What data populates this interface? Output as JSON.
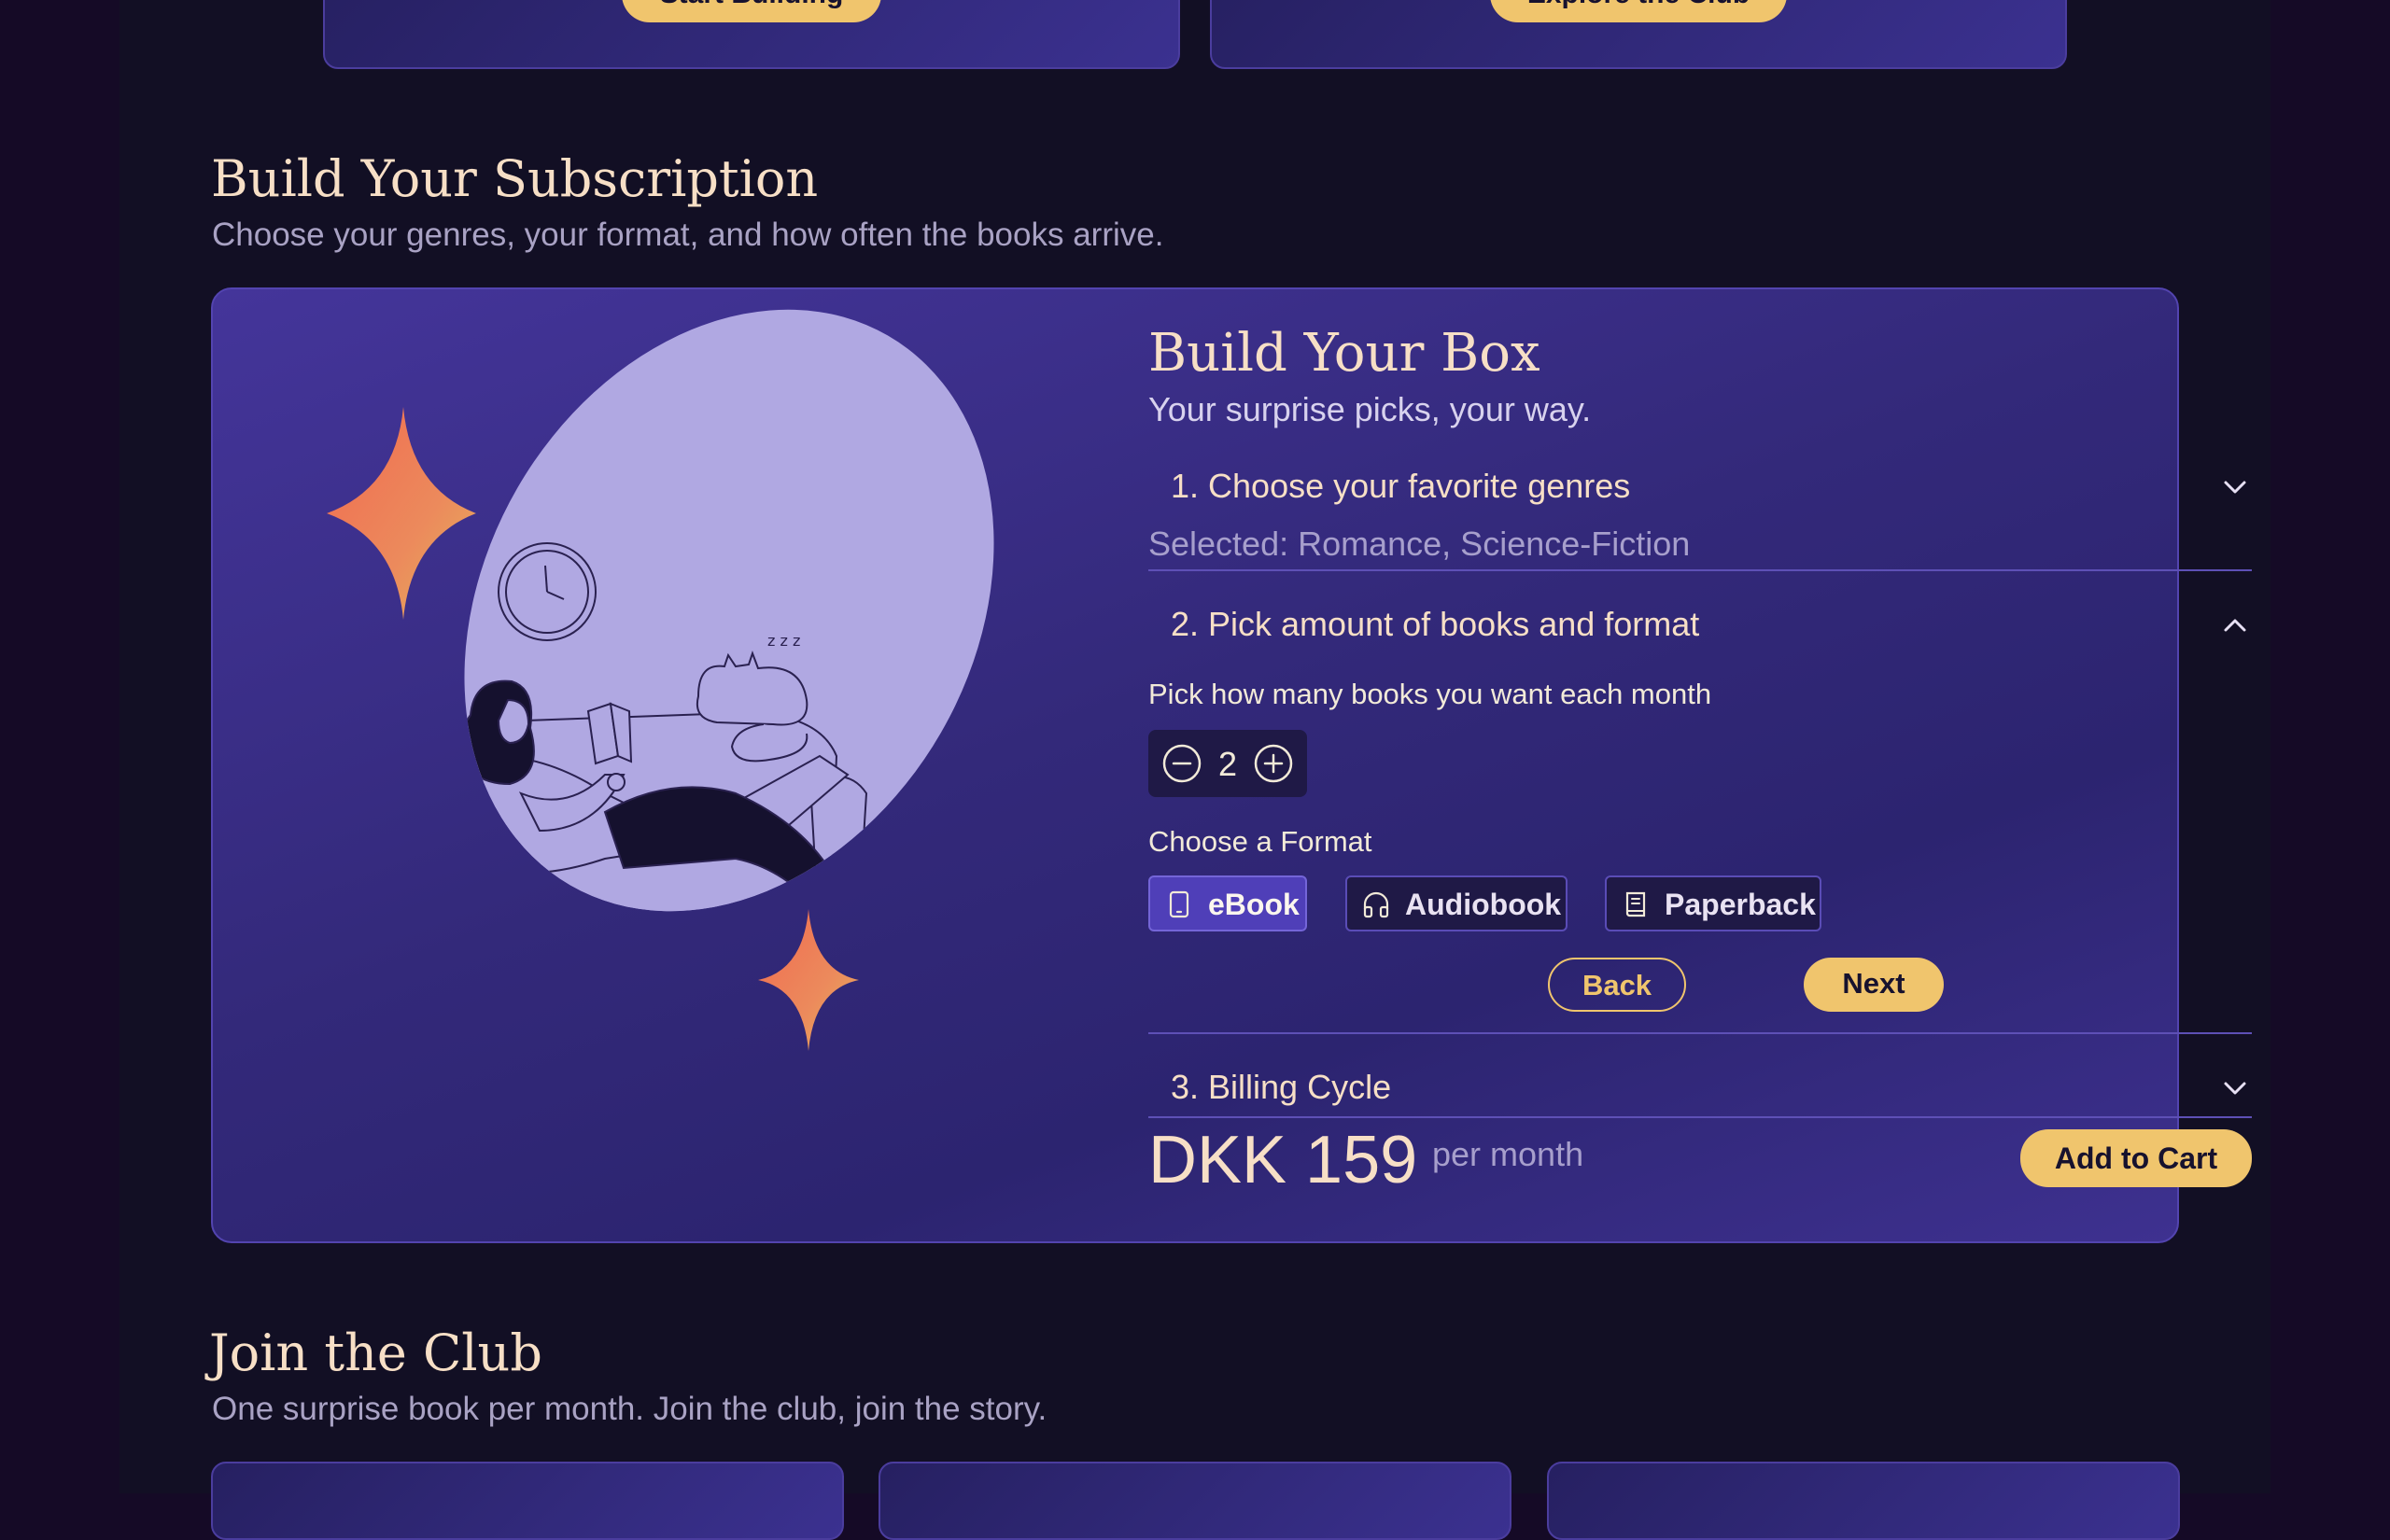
{
  "top_cards": {
    "left_button": "Start Building",
    "right_button": "Explore the Club"
  },
  "subscription_section": {
    "title": "Build Your Subscription",
    "subtitle": "Choose your genres, your format, and how often the books arrive."
  },
  "builder": {
    "title": "Build Your Box",
    "subtitle": "Your surprise picks, your way.",
    "step1": {
      "label": "1. Choose your favorite genres",
      "selected": "Selected: Romance, Science-Fiction",
      "icon": "chevron-down-icon"
    },
    "step2": {
      "label": "2. Pick amount of books and format",
      "icon": "chevron-up-icon",
      "amount_label": "Pick how many books you want each month",
      "amount_value": "2",
      "format_label": "Choose a Format",
      "formats": [
        {
          "label": "eBook",
          "icon": "tablet-icon",
          "selected": true
        },
        {
          "label": "Audiobook",
          "icon": "headphones-icon",
          "selected": false
        },
        {
          "label": "Paperback",
          "icon": "book-icon",
          "selected": false
        }
      ],
      "back_label": "Back",
      "next_label": "Next"
    },
    "step3": {
      "label": "3. Billing Cycle",
      "icon": "chevron-down-icon"
    },
    "price": "DKK 159",
    "price_period": "per month",
    "add_to_cart_label": "Add to Cart"
  },
  "club_section": {
    "title": "Join the Club",
    "subtitle": "One surprise book per month. Join the club, join the story."
  },
  "colors": {
    "accent": "#f0c56d",
    "heading": "#f7dfc6",
    "panel": "#3b2f8a",
    "sparkle": "#ec7c59"
  }
}
